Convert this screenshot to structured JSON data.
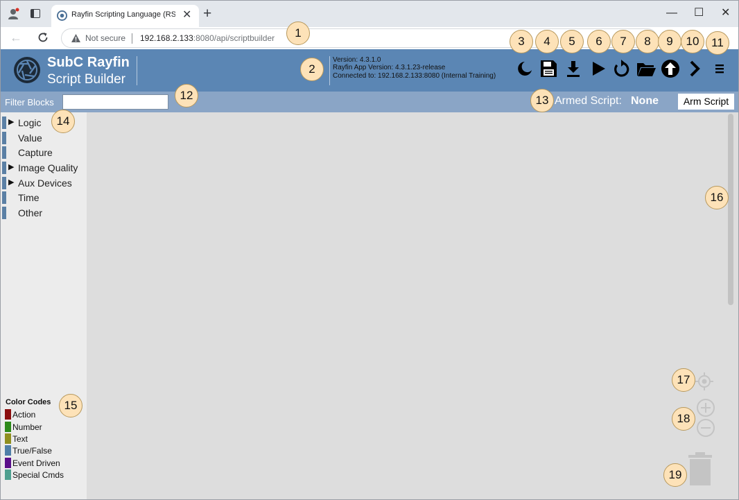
{
  "browser": {
    "tab_title": "Rayfin Scripting Language (RSL) -",
    "tab_close": "✕",
    "new_tab": "+",
    "back": "←",
    "security_label": "Not secure",
    "url_host": "192.168.2.133",
    "url_rest": ":8080/api/scriptbuilder",
    "window_minimize": "—",
    "window_maximize": "☐",
    "window_close": "✕"
  },
  "header": {
    "title_line1": "SubC Rayfin",
    "title_line2": "Script Builder",
    "version": "Version: 4.3.1.0",
    "app_version": "Rayfin App Version: 4.3.1.23-release",
    "connection": "Connected to: 192.168.2.133:8080 (Internal Training)",
    "accent_color": "#5b86b4",
    "toolbar_icons": [
      "dark-mode-moon-icon",
      "save-floppy-icon",
      "download-icon",
      "run-play-icon",
      "reload-icon",
      "open-folder-icon",
      "upload-arrow-icon",
      "next-chevron-icon",
      "menu-hamburger-icon"
    ]
  },
  "filter": {
    "label": "Filter Blocks",
    "value": "",
    "armed_label": "Armed Script:",
    "armed_value": "None",
    "arm_button": "Arm Script"
  },
  "sidebar": {
    "categories": [
      {
        "label": "Logic",
        "expandable": true
      },
      {
        "label": "Value",
        "expandable": false
      },
      {
        "label": "Capture",
        "expandable": false
      },
      {
        "label": "Image Quality",
        "expandable": true
      },
      {
        "label": "Aux Devices",
        "expandable": true
      },
      {
        "label": "Time",
        "expandable": false
      },
      {
        "label": "Other",
        "expandable": false
      }
    ],
    "expand_arrow": "▶",
    "color_codes_title": "Color Codes",
    "color_codes": [
      {
        "label": "Action",
        "color": "#8b0f0f"
      },
      {
        "label": "Number",
        "color": "#2d8a1a"
      },
      {
        "label": "Text",
        "color": "#8f8f1f"
      },
      {
        "label": "True/False",
        "color": "#4f7fa8"
      },
      {
        "label": "Event Driven",
        "color": "#5a0f8a"
      },
      {
        "label": "Special Cmds",
        "color": "#4fa090"
      }
    ]
  },
  "workspace": {
    "controls": [
      "recenter-icon",
      "zoom-in-icon",
      "zoom-out-icon",
      "trash-icon"
    ]
  },
  "callouts": [
    "1",
    "2",
    "3",
    "4",
    "5",
    "6",
    "7",
    "8",
    "9",
    "10",
    "11",
    "12",
    "13",
    "14",
    "15",
    "16",
    "17",
    "18",
    "19"
  ]
}
